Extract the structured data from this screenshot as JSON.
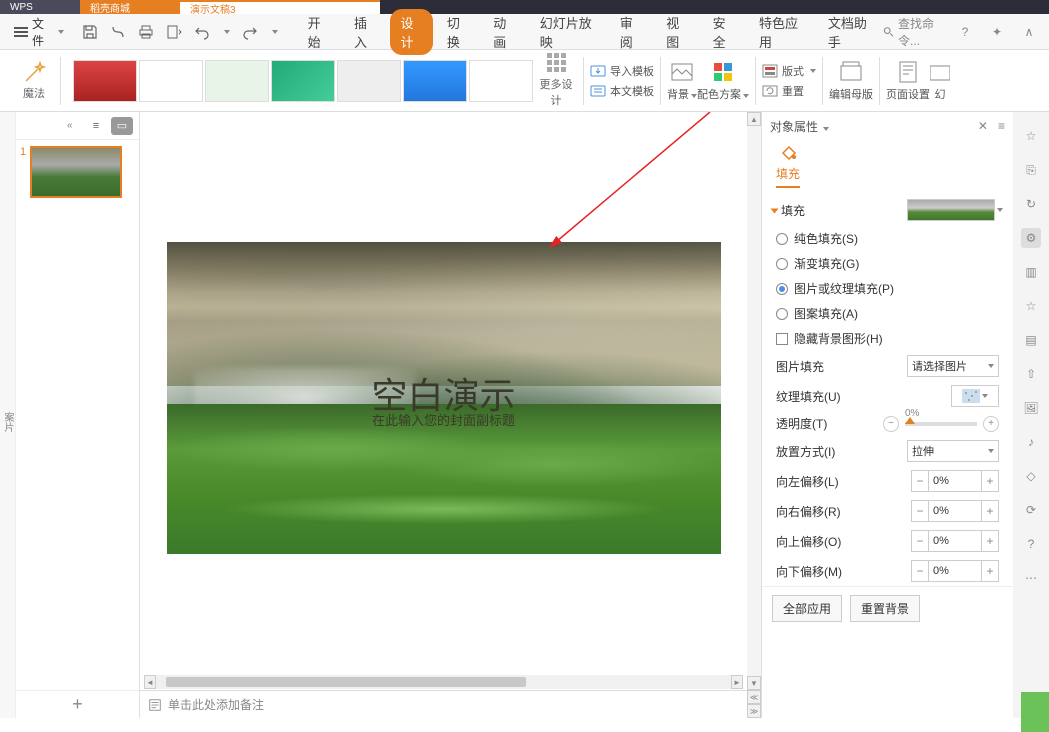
{
  "titlebar": {
    "tab1": "WPS",
    "tab2": "稻壳商城",
    "tab3": "演示文稿3"
  },
  "menubar": {
    "file": "文件",
    "tabs": [
      "开始",
      "插入",
      "设计",
      "切换",
      "动画",
      "幻灯片放映",
      "审阅",
      "视图",
      "安全",
      "特色应用",
      "文档助手"
    ],
    "active": 2,
    "search_placeholder": "查找命令..."
  },
  "ribbon": {
    "magic": "魔法",
    "more_design": "更多设计",
    "import_tmpl": "导入模板",
    "doc_tmpl": "本文模板",
    "background": "背景",
    "color_scheme": "配色方案",
    "layout": "版式",
    "reset": "重置",
    "edit_master": "编辑母版",
    "page_setup": "页面设置",
    "slide_end": "幻"
  },
  "thumbs": {
    "slide1_num": "1"
  },
  "slide": {
    "title": "空白演示",
    "subtitle": "在此输入您的封面副标题"
  },
  "notes": {
    "placeholder": "单击此处添加备注"
  },
  "props": {
    "header": "对象属性",
    "tab_fill": "填充",
    "section_fill": "填充",
    "radio_solid": "纯色填充(S)",
    "radio_gradient": "渐变填充(G)",
    "radio_picture": "图片或纹理填充(P)",
    "radio_pattern": "图案填充(A)",
    "check_hide": "隐藏背景图形(H)",
    "pic_fill": "图片填充",
    "pic_fill_value": "请选择图片",
    "texture_fill": "纹理填充(U)",
    "opacity": "透明度(T)",
    "opacity_value": "0%",
    "placement": "放置方式(I)",
    "placement_value": "拉伸",
    "off_left": "向左偏移(L)",
    "off_right": "向右偏移(R)",
    "off_up": "向上偏移(O)",
    "off_down": "向下偏移(M)",
    "off_val": "0%",
    "apply_all": "全部应用",
    "reset_bg": "重置背景"
  }
}
